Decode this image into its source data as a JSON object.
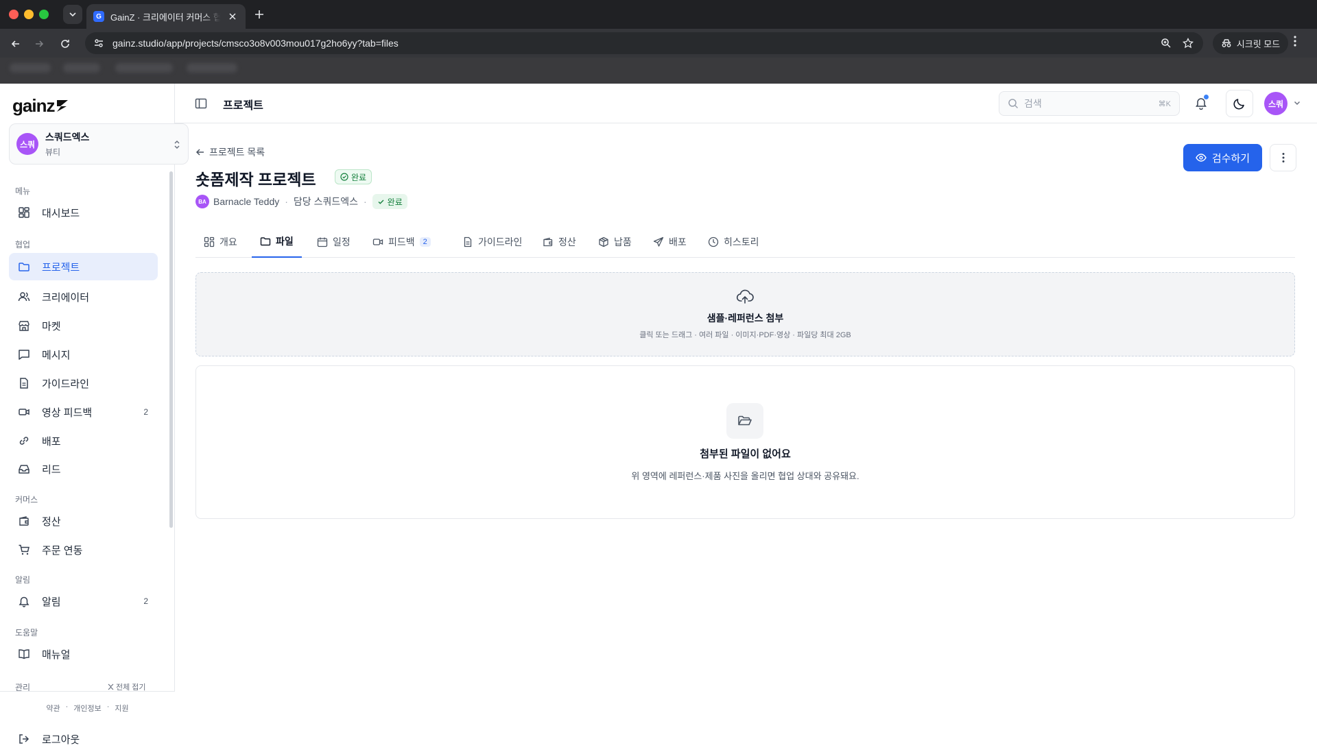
{
  "browser": {
    "tab_favicon": "G",
    "tab_title": "GainZ · 크리에이터 커머스 협업 OS",
    "url": "gainz.studio/app/projects/cmsco3o8v003mou017g2ho6yy?tab=files",
    "incognito_label": "시크릿 모드"
  },
  "sidebar": {
    "logo": "gainz",
    "workspace": {
      "avatar": "스쿼",
      "name": "스쿼드엑스",
      "category": "뷰티"
    },
    "sections": {
      "menu": "메뉴",
      "collab": "협업",
      "commerce": "커머스",
      "alerts": "알림",
      "help": "도움말",
      "admin": "관리"
    },
    "items": {
      "dashboard": "대시보드",
      "projects": "프로젝트",
      "creators": "크리에이터",
      "market": "마켓",
      "messages": "메시지",
      "guidelines": "가이드라인",
      "video_feedback": "영상 피드백",
      "video_feedback_count": "2",
      "distribution": "배포",
      "leads": "리드",
      "settlement": "정산",
      "order_sync": "주문 연동",
      "notifications": "알림",
      "notifications_count": "2",
      "manual": "매뉴얼"
    },
    "collapse_all": "전체 접기",
    "footer_links": [
      "약관",
      "개인정보",
      "지원"
    ],
    "logout": "로그아웃"
  },
  "header": {
    "title": "프로젝트",
    "search_placeholder": "검색",
    "search_shortcut": "⌘K",
    "user_avatar": "스쿼"
  },
  "project": {
    "back_label": "프로젝트 목록",
    "title": "숏폼제작 프로젝트",
    "status": "완료",
    "creator_initials": "BA",
    "creator": "Barnacle Teddy",
    "owner": "담당 스쿼드엑스",
    "sub_status": "완료",
    "review_button": "검수하기"
  },
  "tabs": [
    {
      "label": "개요",
      "icon": "grid-icon"
    },
    {
      "label": "파일",
      "icon": "folder-icon"
    },
    {
      "label": "일정",
      "icon": "calendar-icon"
    },
    {
      "label": "피드백",
      "icon": "video-icon",
      "badge": "2"
    },
    {
      "label": "가이드라인",
      "icon": "document-icon"
    },
    {
      "label": "정산",
      "icon": "wallet-icon"
    },
    {
      "label": "납품",
      "icon": "package-icon"
    },
    {
      "label": "배포",
      "icon": "send-icon"
    },
    {
      "label": "히스토리",
      "icon": "clock-icon"
    }
  ],
  "active_tab": "파일",
  "dropzone": {
    "title": "샘플·레퍼런스 첨부",
    "subtitle": "클릭 또는 드래그 · 여러 파일 · 이미지·PDF·영상 · 파일당 최대 2GB"
  },
  "empty_state": {
    "title": "첨부된 파일이 없어요",
    "subtitle": "위 영역에 레퍼런스·제품 사진을 올리면 협업 상대와 공유돼요."
  },
  "colors": {
    "accent": "#2563eb",
    "active_nav_bg": "#e8eefc",
    "avatar": "#a855f7",
    "success": "#15803d"
  }
}
